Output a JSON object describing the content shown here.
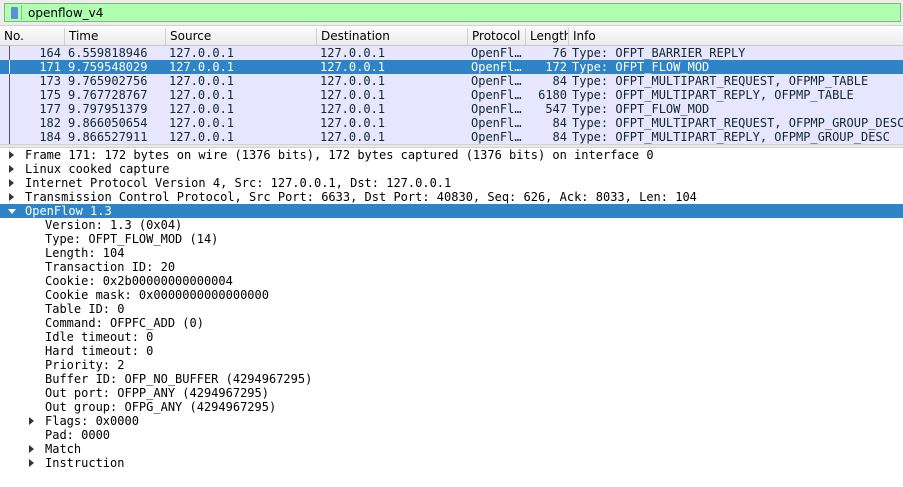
{
  "filter": {
    "value": "openflow_v4"
  },
  "columns": [
    "No.",
    "Time",
    "Source",
    "Destination",
    "Protocol",
    "Length",
    "Info"
  ],
  "packets": [
    {
      "no": "164",
      "time": "6.559818946",
      "src": "127.0.0.1",
      "dst": "127.0.0.1",
      "proto": "OpenFl…",
      "len": "76",
      "info": "Type: OFPT_BARRIER_REPLY",
      "selected": false
    },
    {
      "no": "171",
      "time": "9.759548029",
      "src": "127.0.0.1",
      "dst": "127.0.0.1",
      "proto": "OpenFl…",
      "len": "172",
      "info": "Type: OFPT_FLOW_MOD",
      "selected": true
    },
    {
      "no": "173",
      "time": "9.765902756",
      "src": "127.0.0.1",
      "dst": "127.0.0.1",
      "proto": "OpenFl…",
      "len": "84",
      "info": "Type: OFPT_MULTIPART_REQUEST, OFPMP_TABLE",
      "selected": false
    },
    {
      "no": "175",
      "time": "9.767728767",
      "src": "127.0.0.1",
      "dst": "127.0.0.1",
      "proto": "OpenFl…",
      "len": "6180",
      "info": "Type: OFPT_MULTIPART_REPLY, OFPMP_TABLE",
      "selected": false
    },
    {
      "no": "177",
      "time": "9.797951379",
      "src": "127.0.0.1",
      "dst": "127.0.0.1",
      "proto": "OpenFl…",
      "len": "547",
      "info": "Type: OFPT_FLOW_MOD",
      "selected": false
    },
    {
      "no": "182",
      "time": "9.866050654",
      "src": "127.0.0.1",
      "dst": "127.0.0.1",
      "proto": "OpenFl…",
      "len": "84",
      "info": "Type: OFPT_MULTIPART_REQUEST, OFPMP_GROUP_DESC",
      "selected": false
    },
    {
      "no": "184",
      "time": "9.866527911",
      "src": "127.0.0.1",
      "dst": "127.0.0.1",
      "proto": "OpenFl…",
      "len": "84",
      "info": "Type: OFPT_MULTIPART_REPLY, OFPMP_GROUP_DESC",
      "selected": false
    }
  ],
  "details": [
    {
      "text": "Frame 171: 172 bytes on wire (1376 bits), 172 bytes captured (1376 bits) on interface 0",
      "level": 0,
      "expander": "collapsed",
      "selected": false
    },
    {
      "text": "Linux cooked capture",
      "level": 0,
      "expander": "collapsed",
      "selected": false
    },
    {
      "text": "Internet Protocol Version 4, Src: 127.0.0.1, Dst: 127.0.0.1",
      "level": 0,
      "expander": "collapsed",
      "selected": false
    },
    {
      "text": "Transmission Control Protocol, Src Port: 6633, Dst Port: 40830, Seq: 626, Ack: 8033, Len: 104",
      "level": 0,
      "expander": "collapsed",
      "selected": false
    },
    {
      "text": "OpenFlow 1.3",
      "level": 0,
      "expander": "expanded",
      "selected": true
    },
    {
      "text": "Version: 1.3 (0x04)",
      "level": 1,
      "expander": "none",
      "selected": false
    },
    {
      "text": "Type: OFPT_FLOW_MOD (14)",
      "level": 1,
      "expander": "none",
      "selected": false
    },
    {
      "text": "Length: 104",
      "level": 1,
      "expander": "none",
      "selected": false
    },
    {
      "text": "Transaction ID: 20",
      "level": 1,
      "expander": "none",
      "selected": false
    },
    {
      "text": "Cookie: 0x2b00000000000004",
      "level": 1,
      "expander": "none",
      "selected": false
    },
    {
      "text": "Cookie mask: 0x0000000000000000",
      "level": 1,
      "expander": "none",
      "selected": false
    },
    {
      "text": "Table ID: 0",
      "level": 1,
      "expander": "none",
      "selected": false
    },
    {
      "text": "Command: OFPFC_ADD (0)",
      "level": 1,
      "expander": "none",
      "selected": false
    },
    {
      "text": "Idle timeout: 0",
      "level": 1,
      "expander": "none",
      "selected": false
    },
    {
      "text": "Hard timeout: 0",
      "level": 1,
      "expander": "none",
      "selected": false
    },
    {
      "text": "Priority: 2",
      "level": 1,
      "expander": "none",
      "selected": false
    },
    {
      "text": "Buffer ID: OFP_NO_BUFFER (4294967295)",
      "level": 1,
      "expander": "none",
      "selected": false
    },
    {
      "text": "Out port: OFPP_ANY (4294967295)",
      "level": 1,
      "expander": "none",
      "selected": false
    },
    {
      "text": "Out group: OFPG_ANY (4294967295)",
      "level": 1,
      "expander": "none",
      "selected": false
    },
    {
      "text": "Flags: 0x0000",
      "level": 1,
      "expander": "collapsed",
      "selected": false
    },
    {
      "text": "Pad: 0000",
      "level": 1,
      "expander": "none",
      "selected": false
    },
    {
      "text": "Match",
      "level": 1,
      "expander": "collapsed",
      "selected": false
    },
    {
      "text": "Instruction",
      "level": 1,
      "expander": "collapsed",
      "selected": false
    }
  ],
  "colors": {
    "filter_valid": "#afffaf",
    "row_openflow": "#e7e6ff",
    "row_selected": "#2f83c7"
  },
  "icons": {
    "filter_bookmark": "bookmark-icon",
    "expander_collapsed": "triangle-right-icon",
    "expander_expanded": "triangle-down-icon"
  }
}
